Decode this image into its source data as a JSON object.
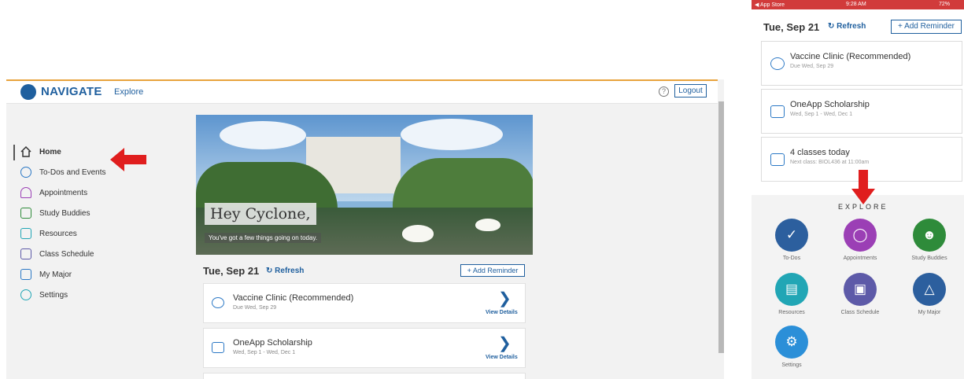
{
  "desktop": {
    "brand": "NAVIGATE",
    "explore_link": "Explore",
    "help_glyph": "?",
    "logout": "Logout",
    "sidebar": [
      {
        "label": "Home",
        "icon": "home-icon"
      },
      {
        "label": "To-Dos and Events",
        "icon": "todo-apple-icon"
      },
      {
        "label": "Appointments",
        "icon": "person-icon"
      },
      {
        "label": "Study Buddies",
        "icon": "group-icon"
      },
      {
        "label": "Resources",
        "icon": "book-icon"
      },
      {
        "label": "Class Schedule",
        "icon": "schedule-icon"
      },
      {
        "label": "My Major",
        "icon": "graduation-cap-icon"
      },
      {
        "label": "Settings",
        "icon": "gear-icon"
      }
    ],
    "hero": {
      "title": "Hey Cyclone,",
      "subtitle": "You've got a few things going on today."
    },
    "date": "Tue, Sep 21",
    "refresh": "Refresh",
    "add_reminder": "Add Reminder",
    "cards": [
      {
        "title": "Vaccine Clinic (Recommended)",
        "sub": "Due Wed, Sep 29",
        "action": "View Details",
        "icon": "apple-check-icon"
      },
      {
        "title": "OneApp Scholarship",
        "sub": "Wed, Sep 1 - Wed, Dec 1",
        "action": "View Details",
        "icon": "calendar-icon"
      }
    ]
  },
  "phone": {
    "status": {
      "carrier": "◀ App Store",
      "time": "9:28 AM",
      "battery": "72%"
    },
    "date": "Tue, Sep 21",
    "refresh": "Refresh",
    "add_reminder": "Add Reminder",
    "cards": [
      {
        "title": "Vaccine Clinic (Recommended)",
        "sub": "Due Wed, Sep 29"
      },
      {
        "title": "OneApp Scholarship",
        "sub": "Wed, Sep 1 - Wed, Dec 1"
      },
      {
        "title": "4 classes today",
        "sub": "Next class: BIOL436 at 11:00am"
      }
    ],
    "explore_label": "EXPLORE",
    "explore_items": [
      {
        "label": "To-Dos",
        "color": "#2c5f9e",
        "icon": "todo-icon"
      },
      {
        "label": "Appointments",
        "color": "#9b3fb5",
        "icon": "person-icon"
      },
      {
        "label": "Study Buddies",
        "color": "#2e8b3a",
        "icon": "group-icon"
      },
      {
        "label": "Resources",
        "color": "#21a6b5",
        "icon": "book-icon"
      },
      {
        "label": "Class Schedule",
        "color": "#5d5aa8",
        "icon": "schedule-icon"
      },
      {
        "label": "My Major",
        "color": "#2c5f9e",
        "icon": "graduation-cap-icon"
      },
      {
        "label": "Settings",
        "color": "#2b8fd8",
        "icon": "gear-icon"
      }
    ]
  },
  "colors": {
    "brand": "#1f5f9e",
    "arrow": "#e01e1e",
    "accent_top": "#e8a33d"
  }
}
